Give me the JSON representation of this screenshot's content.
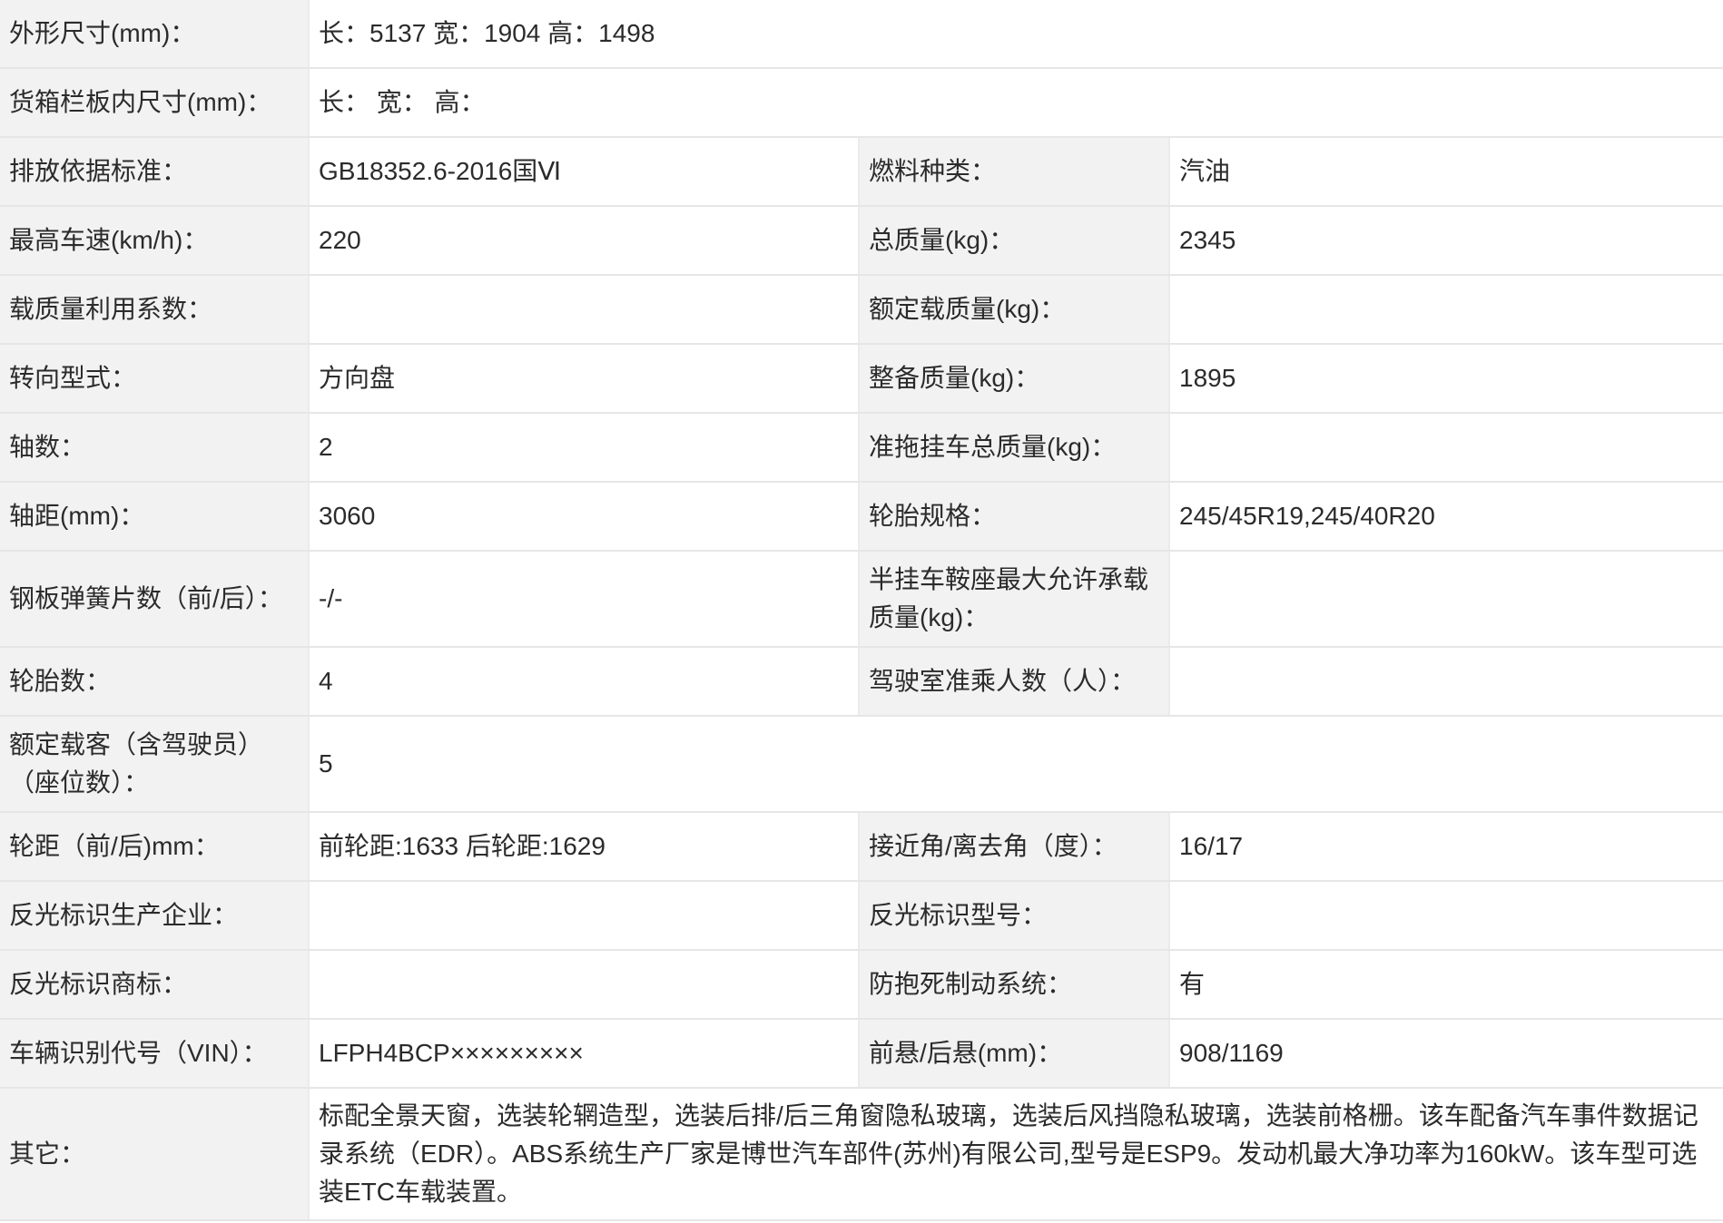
{
  "rows": [
    {
      "type": "full",
      "label": "外形尺寸(mm)：",
      "value": "长：5137 宽：1904 高：1498"
    },
    {
      "type": "full",
      "label": "货箱栏板内尺寸(mm)：",
      "value": "长： 宽： 高："
    },
    {
      "type": "pair",
      "label1": "排放依据标准：",
      "value1": "GB18352.6-2016国Ⅵ",
      "label2": "燃料种类：",
      "value2": "汽油"
    },
    {
      "type": "pair",
      "label1": "最高车速(km/h)：",
      "value1": "220",
      "label2": "总质量(kg)：",
      "value2": "2345"
    },
    {
      "type": "pair",
      "label1": "载质量利用系数：",
      "value1": "",
      "label2": "额定载质量(kg)：",
      "value2": ""
    },
    {
      "type": "pair",
      "label1": "转向型式：",
      "value1": "方向盘",
      "label2": "整备质量(kg)：",
      "value2": "1895"
    },
    {
      "type": "pair",
      "label1": "轴数：",
      "value1": "2",
      "label2": "准拖挂车总质量(kg)：",
      "value2": ""
    },
    {
      "type": "pair",
      "label1": "轴距(mm)：",
      "value1": "3060",
      "label2": "轮胎规格：",
      "value2": "245/45R19,245/40R20"
    },
    {
      "type": "pair",
      "label1": "钢板弹簧片数（前/后）：",
      "value1": "-/-",
      "label2": "半挂车鞍座最大允许承载质量(kg)：",
      "value2": ""
    },
    {
      "type": "pair",
      "label1": "轮胎数：",
      "value1": "4",
      "label2": "驾驶室准乘人数（人）：",
      "value2": ""
    },
    {
      "type": "full",
      "label": "额定载客（含驾驶员）（座位数）：",
      "value": "5"
    },
    {
      "type": "pair",
      "label1": "轮距（前/后)mm：",
      "value1": "前轮距:1633 后轮距:1629",
      "label2": "接近角/离去角（度）：",
      "value2": "16/17"
    },
    {
      "type": "pair",
      "label1": "反光标识生产企业：",
      "value1": "",
      "label2": "反光标识型号：",
      "value2": ""
    },
    {
      "type": "pair",
      "label1": "反光标识商标：",
      "value1": "",
      "label2": "防抱死制动系统：",
      "value2": "有"
    },
    {
      "type": "pair",
      "label1": "车辆识别代号（VIN）：",
      "value1": "LFPH4BCP×××××××××",
      "label2": "前悬/后悬(mm)：",
      "value2": "908/1169"
    },
    {
      "type": "full",
      "label": "其它：",
      "value": "标配全景天窗，选装轮辋造型，选装后排/后三角窗隐私玻璃，选装后风挡隐私玻璃，选装前格栅。该车配备汽车事件数据记录系统（EDR）。ABS系统生产厂家是博世汽车部件(苏州)有限公司,型号是ESP9。发动机最大净功率为160kW。该车型可选装ETC车载装置。"
    }
  ]
}
